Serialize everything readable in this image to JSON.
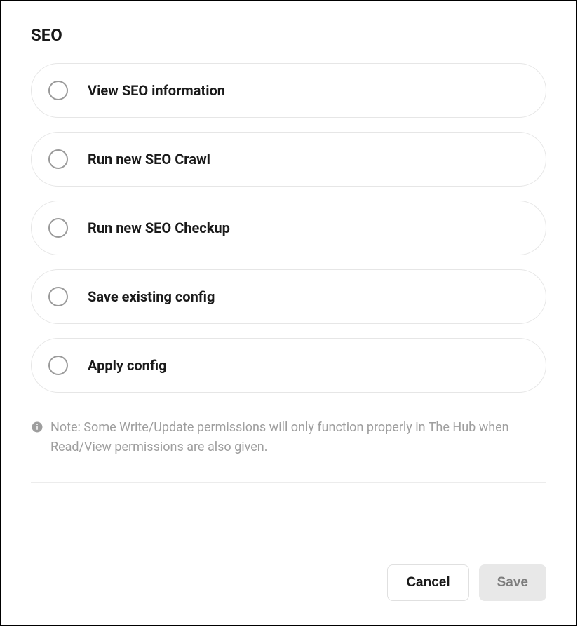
{
  "section": {
    "title": "SEO"
  },
  "options": [
    {
      "label": "View SEO information"
    },
    {
      "label": "Run new SEO Crawl"
    },
    {
      "label": "Run new SEO Checkup"
    },
    {
      "label": "Save existing config"
    },
    {
      "label": "Apply config"
    }
  ],
  "note": {
    "text": "Note: Some Write/Update permissions will only function properly in The Hub when Read/View permissions are also given."
  },
  "buttons": {
    "cancel": "Cancel",
    "save": "Save"
  }
}
